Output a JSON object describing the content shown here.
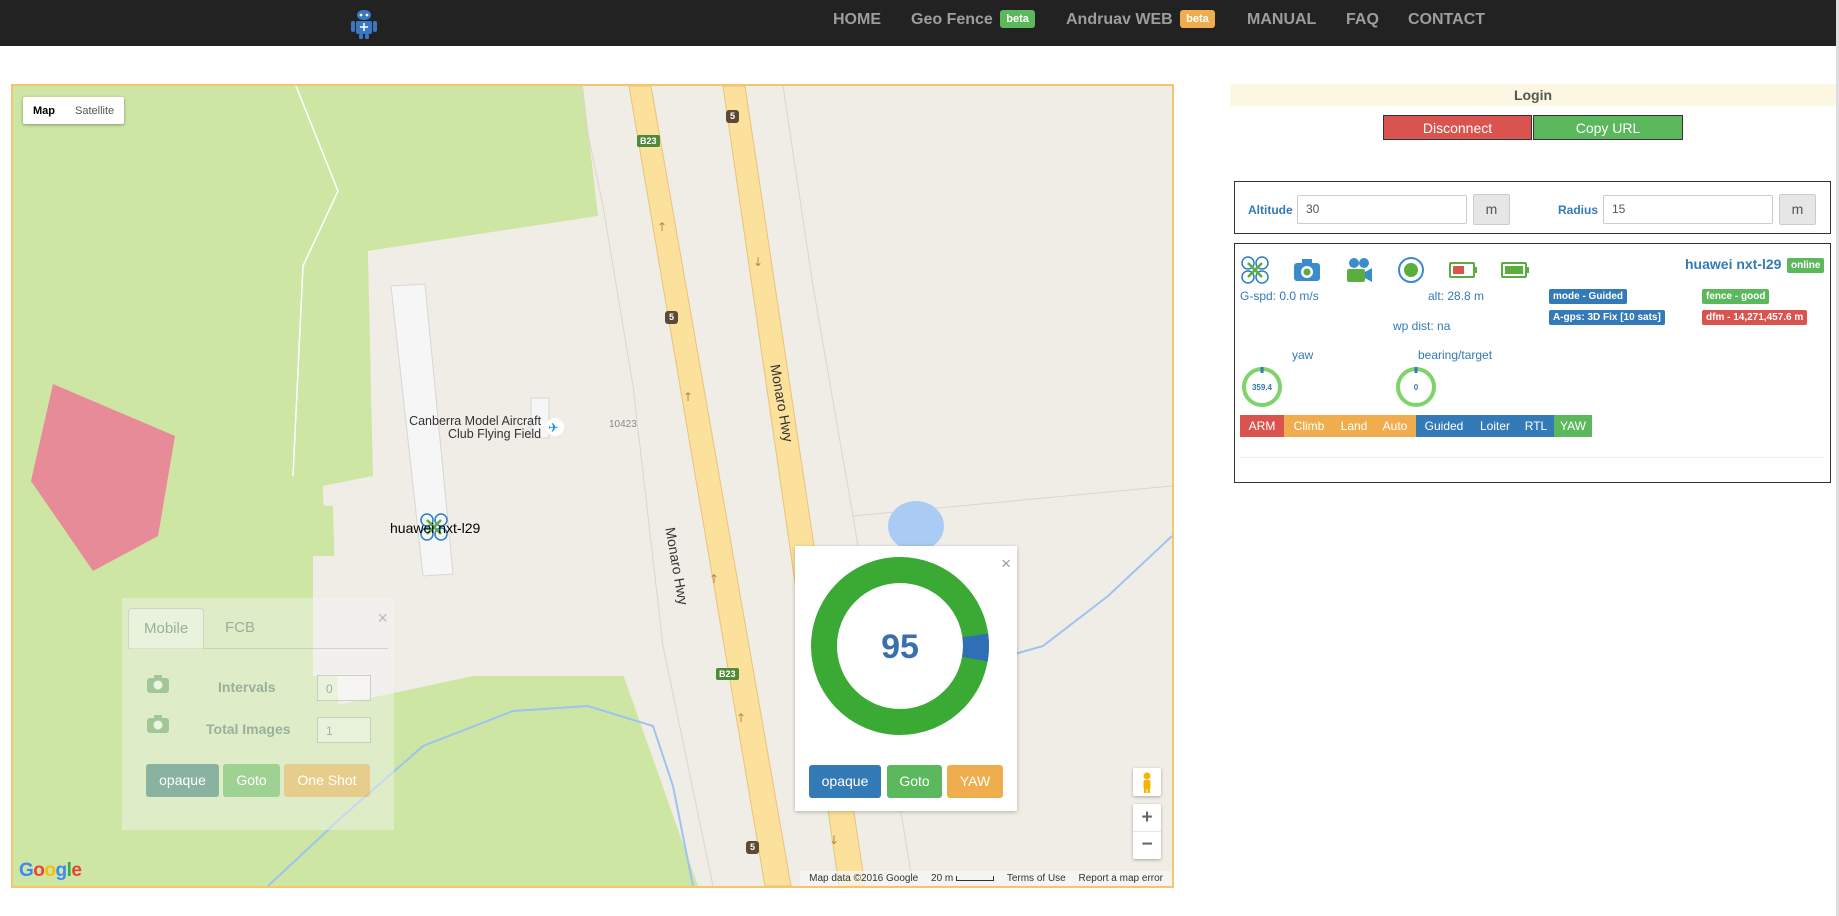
{
  "nav": {
    "items": [
      {
        "label": "HOME"
      },
      {
        "label": "Geo Fence",
        "badge": "beta",
        "badge_color": "#5cb85c"
      },
      {
        "label": "Andruav WEB",
        "badge": "beta",
        "badge_color": "#f0ad4e"
      },
      {
        "label": "MANUAL"
      },
      {
        "label": "FAQ"
      },
      {
        "label": "CONTACT"
      }
    ]
  },
  "map": {
    "map_type_buttons": [
      "Map",
      "Satellite"
    ],
    "labels": {
      "airfield_line1": "Canberra Model Aircraft",
      "airfield_line2": "Club Flying Field",
      "road_code": "10423",
      "highway_1": "Monaro Hwy",
      "highway_2": "Monaro Hwy",
      "shield_b23_top": "B23",
      "shield_b23_bottom": "B23",
      "shield_5_a": "5",
      "shield_5_b": "5",
      "shield_5_c": "5",
      "drone_label": "huawei nxt-l29"
    },
    "mobile_panel": {
      "tabs": [
        "Mobile",
        "FCB"
      ],
      "close": "×",
      "intervals_label": "Intervals",
      "intervals_value": "0",
      "total_images_label": "Total Images",
      "total_images_value": "1",
      "buttons": [
        "opaque",
        "Goto",
        "One Shot"
      ]
    },
    "popup": {
      "close": "×",
      "value": "95",
      "gauge_fraction": 0.95,
      "buttons": [
        "opaque",
        "Goto",
        "YAW"
      ]
    },
    "zoom_in": "+",
    "zoom_out": "−",
    "google_logo": "Google",
    "attribution": {
      "map_data": "Map data ©2016 Google",
      "scale": "20 m",
      "terms": "Terms of Use",
      "report": "Report a map error"
    }
  },
  "panel": {
    "login_title": "Login",
    "disconnect_label": "Disconnect",
    "copy_url_label": "Copy URL",
    "altitude_label": "Altitude",
    "altitude_value": "30",
    "altitude_unit": "m",
    "radius_label": "Radius",
    "radius_value": "15",
    "radius_unit": "m"
  },
  "unit": {
    "name": "huawei nxt-l29",
    "status": "online",
    "icons": [
      "drone-icon",
      "camera-icon",
      "video-camera-icon",
      "record-icon",
      "battery-low-icon",
      "battery-full-icon"
    ],
    "gspd": "G-spd: 0.0 m/s",
    "alt": "alt: 28.8 m",
    "wp_dist": "wp dist: na",
    "mode": "mode - Guided",
    "gps": "A-gps: 3D Fix [10 sats]",
    "fence": "fence - good",
    "dfm": "dfm - 14,271,457.6 m",
    "yaw_label": "yaw",
    "yaw_value": "359.4",
    "bearing_label": "bearing/target",
    "bearing_value": "0",
    "commands": [
      {
        "label": "ARM",
        "color": "#d9534f"
      },
      {
        "label": "Climb",
        "color": "#f0ad4e"
      },
      {
        "label": "Land",
        "color": "#f0ad4e"
      },
      {
        "label": "Auto",
        "color": "#f0ad4e"
      },
      {
        "label": "Guided",
        "color": "#337ab7"
      },
      {
        "label": "Loiter",
        "color": "#337ab7"
      },
      {
        "label": "RTL",
        "color": "#337ab7"
      },
      {
        "label": "YAW",
        "color": "#5cb85c"
      }
    ]
  },
  "colors": {
    "navbar": "#222222",
    "primary": "#337ab7",
    "success": "#5cb85c",
    "warning": "#f0ad4e",
    "danger": "#d9534f",
    "park_green": "#cde6a4",
    "road_yellow": "#fbe19b",
    "fence_pink": "#e88699",
    "gauge_green": "#3aaa35"
  }
}
